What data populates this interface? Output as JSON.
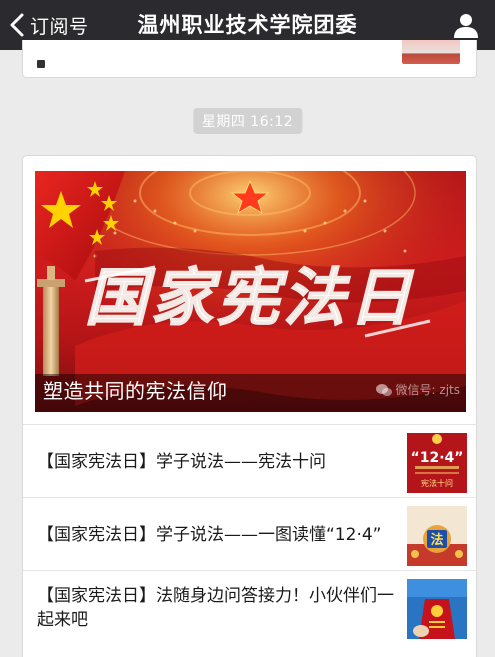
{
  "navbar": {
    "back_label": "订阅号",
    "title": "温州职业技术学院团委"
  },
  "timestamp": "星期四 16:12",
  "article": {
    "cover_title": "塑造共同的宪法信仰",
    "cover_banner_text": "国家宪法日",
    "cover_watermark": "微信号: zjts"
  },
  "list": [
    {
      "title": "【国家宪法日】学子说法——宪法十问",
      "thumb_big": "“12·4”",
      "thumb_small": "宪法十问"
    },
    {
      "title": "【国家宪法日】学子说法——一图读懂“12·4”",
      "thumb_glyph": "法"
    },
    {
      "title": "【国家宪法日】法随身边问答接力！小伙伴们一起来吧"
    }
  ],
  "colors": {
    "navbar_bg": "#2b2b2f",
    "page_bg": "#ebebeb",
    "accent_red": "#c8161d"
  }
}
